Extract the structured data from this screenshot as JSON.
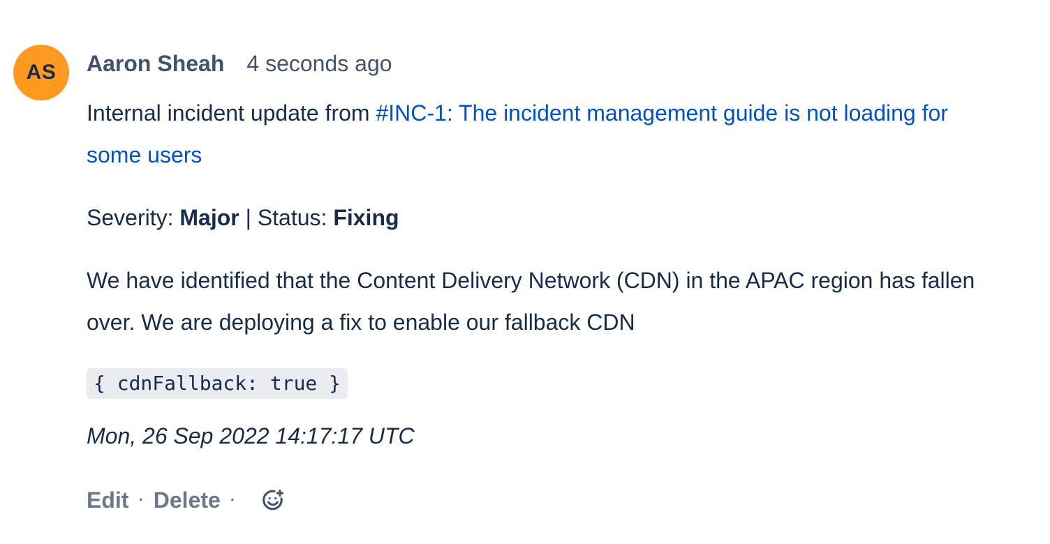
{
  "comment": {
    "avatar_initials": "AS",
    "avatar_color": "#ff991f",
    "author": "Aaron Sheah",
    "time_ago": "4 seconds ago",
    "intro_text": "Internal incident update from ",
    "issue_link": "#INC-1: The incident management guide is not loading for some users",
    "severity_label": "Severity: ",
    "severity_value": "Major",
    "status_separator": " | Status: ",
    "status_value": "Fixing",
    "detail_text": "We have identified that the Content Delivery Network (CDN) in the APAC region has fallen over. We are deploying a fix to enable our fallback CDN",
    "code_snippet": "{ cdnFallback: true }",
    "timestamp": "Mon, 26 Sep 2022 14:17:17 UTC"
  },
  "actions": {
    "edit_label": "Edit",
    "delete_label": "Delete",
    "separator": "·",
    "reaction_icon": "add-reaction-icon"
  },
  "colors": {
    "link": "#0052cc",
    "text": "#172b4d",
    "muted": "#42526e",
    "action": "#6b778c",
    "code_bg": "#ebecf0"
  }
}
